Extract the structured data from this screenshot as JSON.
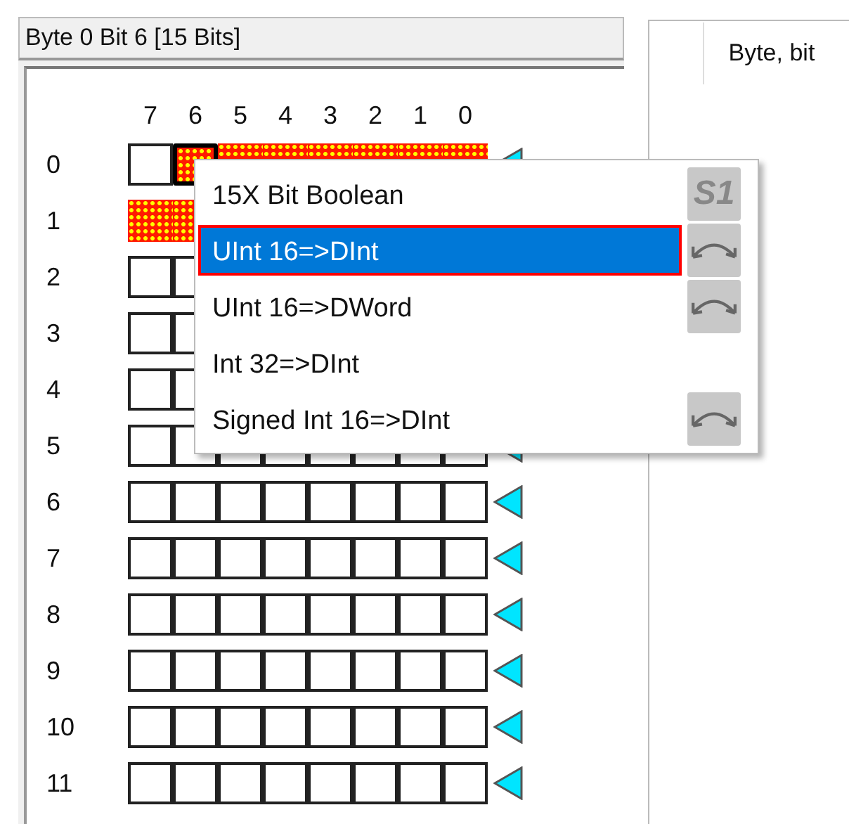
{
  "panel": {
    "title": "Byte 0 Bit 6 [15 Bits]",
    "bit_headers": [
      "7",
      "6",
      "5",
      "4",
      "3",
      "2",
      "1",
      "0"
    ],
    "rows": [
      {
        "label": "0",
        "bits": [
          {
            "selected": false,
            "cursor": false
          },
          {
            "selected": true,
            "cursor": true
          },
          {
            "selected": true,
            "cursor": false
          },
          {
            "selected": true,
            "cursor": false
          },
          {
            "selected": true,
            "cursor": false
          },
          {
            "selected": true,
            "cursor": false
          },
          {
            "selected": true,
            "cursor": false
          },
          {
            "selected": true,
            "cursor": false
          }
        ]
      },
      {
        "label": "1",
        "bits": [
          {
            "selected": true,
            "cursor": false
          },
          {
            "selected": true,
            "cursor": false
          }
        ]
      },
      {
        "label": "2",
        "bits": [
          {
            "selected": false,
            "cursor": false
          },
          {
            "selected": false,
            "cursor": false
          }
        ]
      },
      {
        "label": "3",
        "bits": [
          {
            "selected": false,
            "cursor": false
          },
          {
            "selected": false,
            "cursor": false
          }
        ]
      },
      {
        "label": "4",
        "bits": [
          {
            "selected": false,
            "cursor": false
          },
          {
            "selected": false,
            "cursor": false
          }
        ]
      },
      {
        "label": "5",
        "bits": [
          {
            "selected": false,
            "cursor": false
          },
          {
            "selected": false,
            "cursor": false
          },
          {
            "selected": false,
            "cursor": false
          },
          {
            "selected": false,
            "cursor": false
          },
          {
            "selected": false,
            "cursor": false
          },
          {
            "selected": false,
            "cursor": false
          },
          {
            "selected": false,
            "cursor": false
          },
          {
            "selected": false,
            "cursor": false
          }
        ]
      },
      {
        "label": "6",
        "bits": [
          {
            "selected": false,
            "cursor": false
          },
          {
            "selected": false,
            "cursor": false
          },
          {
            "selected": false,
            "cursor": false
          },
          {
            "selected": false,
            "cursor": false
          },
          {
            "selected": false,
            "cursor": false
          },
          {
            "selected": false,
            "cursor": false
          },
          {
            "selected": false,
            "cursor": false
          },
          {
            "selected": false,
            "cursor": false
          }
        ]
      },
      {
        "label": "7",
        "bits": [
          {
            "selected": false,
            "cursor": false
          },
          {
            "selected": false,
            "cursor": false
          },
          {
            "selected": false,
            "cursor": false
          },
          {
            "selected": false,
            "cursor": false
          },
          {
            "selected": false,
            "cursor": false
          },
          {
            "selected": false,
            "cursor": false
          },
          {
            "selected": false,
            "cursor": false
          },
          {
            "selected": false,
            "cursor": false
          }
        ]
      },
      {
        "label": "8",
        "bits": [
          {
            "selected": false,
            "cursor": false
          },
          {
            "selected": false,
            "cursor": false
          },
          {
            "selected": false,
            "cursor": false
          },
          {
            "selected": false,
            "cursor": false
          },
          {
            "selected": false,
            "cursor": false
          },
          {
            "selected": false,
            "cursor": false
          },
          {
            "selected": false,
            "cursor": false
          },
          {
            "selected": false,
            "cursor": false
          }
        ]
      },
      {
        "label": "9",
        "bits": [
          {
            "selected": false,
            "cursor": false
          },
          {
            "selected": false,
            "cursor": false
          },
          {
            "selected": false,
            "cursor": false
          },
          {
            "selected": false,
            "cursor": false
          },
          {
            "selected": false,
            "cursor": false
          },
          {
            "selected": false,
            "cursor": false
          },
          {
            "selected": false,
            "cursor": false
          },
          {
            "selected": false,
            "cursor": false
          }
        ]
      },
      {
        "label": "10",
        "bits": [
          {
            "selected": false,
            "cursor": false
          },
          {
            "selected": false,
            "cursor": false
          },
          {
            "selected": false,
            "cursor": false
          },
          {
            "selected": false,
            "cursor": false
          },
          {
            "selected": false,
            "cursor": false
          },
          {
            "selected": false,
            "cursor": false
          },
          {
            "selected": false,
            "cursor": false
          },
          {
            "selected": false,
            "cursor": false
          }
        ]
      },
      {
        "label": "11",
        "bits": [
          {
            "selected": false,
            "cursor": false
          },
          {
            "selected": false,
            "cursor": false
          },
          {
            "selected": false,
            "cursor": false
          },
          {
            "selected": false,
            "cursor": false
          },
          {
            "selected": false,
            "cursor": false
          },
          {
            "selected": false,
            "cursor": false
          },
          {
            "selected": false,
            "cursor": false
          },
          {
            "selected": false,
            "cursor": false
          }
        ]
      }
    ]
  },
  "right_panel": {
    "column_header": "Byte, bit"
  },
  "context_menu": {
    "items": [
      {
        "label": "15X Bit Boolean",
        "selected": false,
        "icon": {
          "kind": "text",
          "text": "S1"
        }
      },
      {
        "label": "UInt 16=>DInt",
        "selected": true,
        "icon": {
          "kind": "curve"
        }
      },
      {
        "label": "UInt 16=>DWord",
        "selected": false,
        "icon": {
          "kind": "curve"
        }
      },
      {
        "label": "Int 32=>DInt",
        "selected": false
      },
      {
        "label": "Signed Int 16=>DInt",
        "selected": false,
        "icon": {
          "kind": "curve"
        }
      }
    ]
  }
}
